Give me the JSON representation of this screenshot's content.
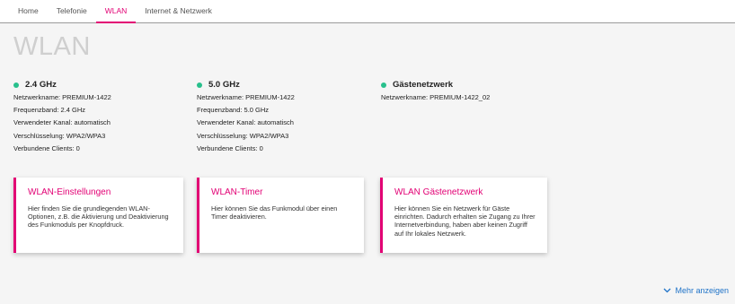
{
  "nav": {
    "tabs": [
      {
        "label": "Home"
      },
      {
        "label": "Telefonie"
      },
      {
        "label": "WLAN"
      },
      {
        "label": "Internet & Netzwerk"
      }
    ],
    "active_tab": "WLAN"
  },
  "page": {
    "title": "WLAN"
  },
  "bands": [
    {
      "name": "2.4 GHz",
      "status_color": "#28c08c",
      "lines": [
        "Netzwerkname: PREMIUM-1422",
        "Frequenzband: 2.4 GHz",
        "Verwendeter Kanal: automatisch",
        "Verschlüsselung: WPA2/WPA3",
        "Verbundene Clients: 0"
      ]
    },
    {
      "name": "5.0 GHz",
      "status_color": "#28c08c",
      "lines": [
        "Netzwerkname: PREMIUM-1422",
        "Frequenzband: 5.0 GHz",
        "Verwendeter Kanal: automatisch",
        "Verschlüsselung: WPA2/WPA3",
        "Verbundene Clients: 0"
      ]
    },
    {
      "name": "Gästenetzwerk",
      "status_color": "#28c08c",
      "lines": [
        "Netzwerkname: PREMIUM-1422_02"
      ]
    }
  ],
  "cards": [
    {
      "title": "WLAN-Einstellungen",
      "text": "Hier finden Sie die grundlegenden WLAN-Optionen, z.B. die Aktivierung und Deaktivierung des Funkmoduls per Knopfdruck."
    },
    {
      "title": "WLAN-Timer",
      "text": "Hier können Sie das Funkmodul über einen Timer deaktivieren."
    },
    {
      "title": "WLAN Gästenetzwerk",
      "text": "Hier können Sie ein Netzwerk für Gäste einrichten. Dadurch erhalten sie Zugang zu Ihrer Internetverbindung, haben aber keinen Zugriff auf Ihr lokales Netzwerk."
    }
  ],
  "more": {
    "label": "Mehr anzeigen",
    "icon": "chevron-down-icon"
  },
  "colors": {
    "accent": "#e20074",
    "status_ok": "#28c08c",
    "link": "#1f73c8",
    "title_gray": "#cfcfcf"
  }
}
